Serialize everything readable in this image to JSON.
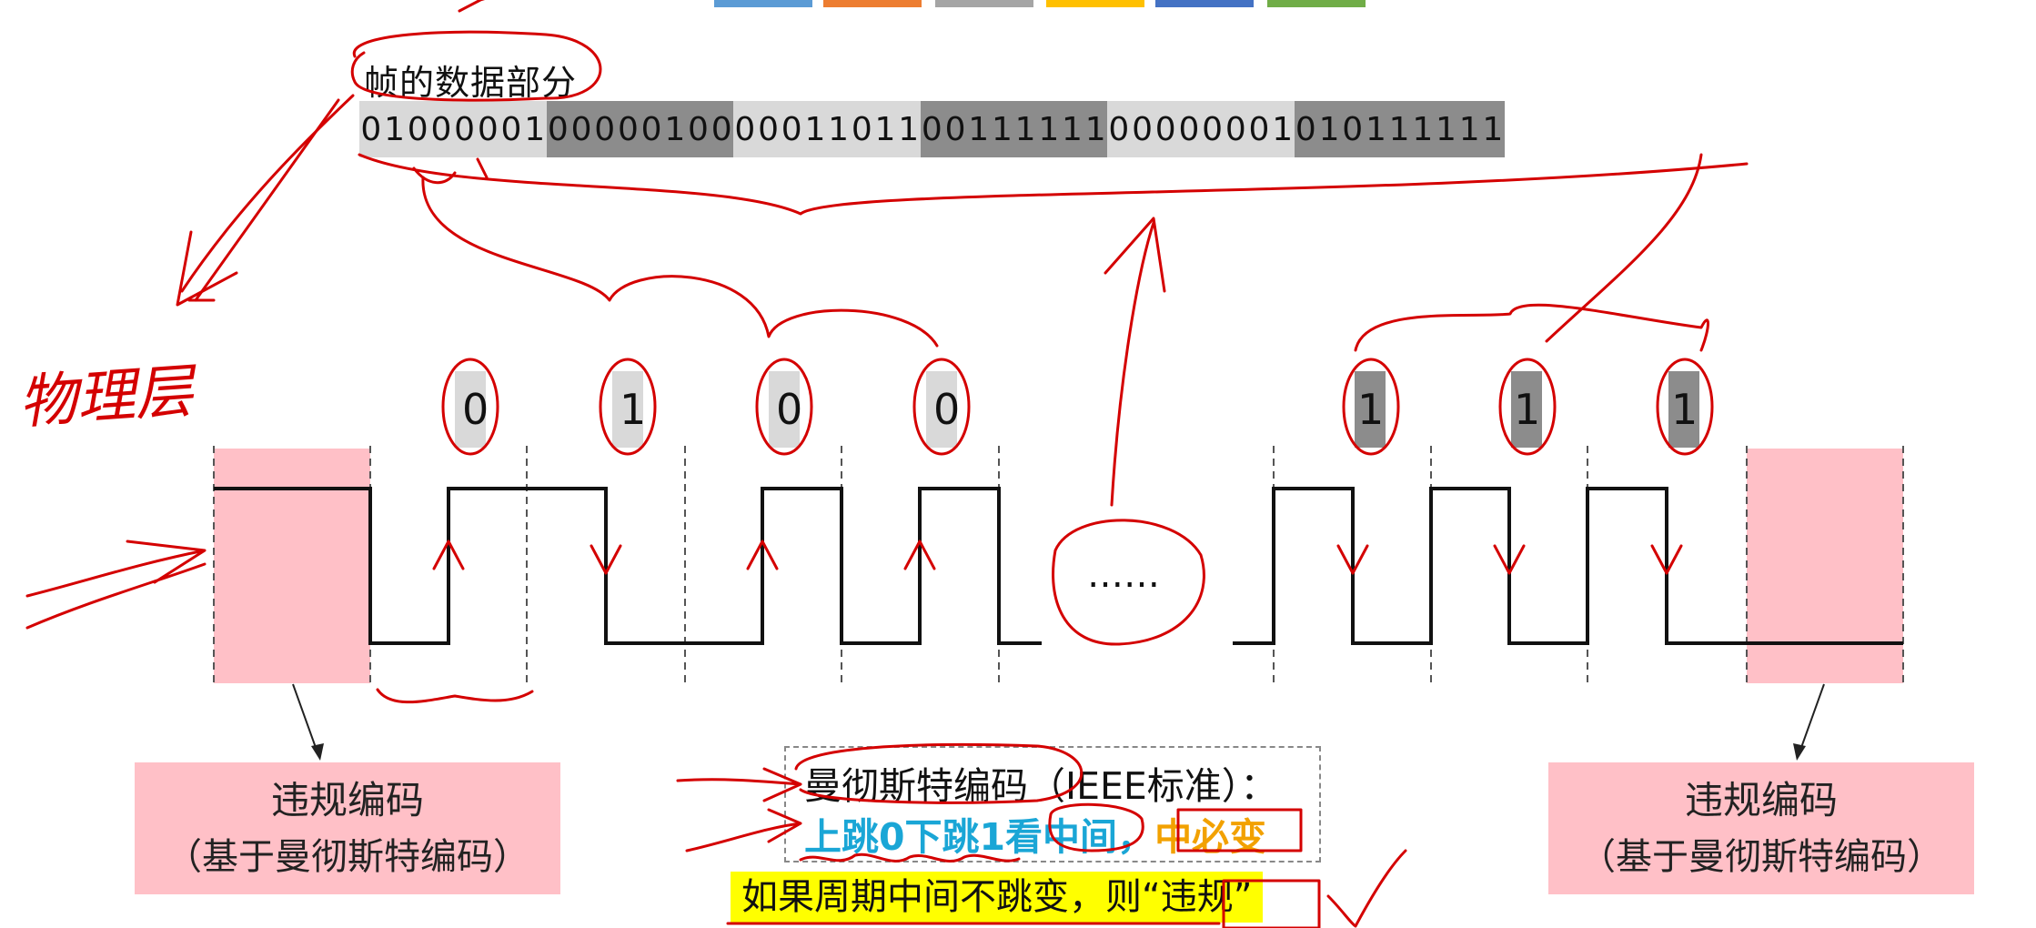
{
  "top_tab_colors": [
    "#5b9bd5",
    "#ed7d31",
    "#a5a5a5",
    "#ffc000",
    "#4472c4",
    "#70ad47"
  ],
  "frame_label": "帧的数据部分",
  "bit_string": "0100000100000100000110110011111100000001010111111",
  "bit_group_colors": [
    "#d9d9d9",
    "#8c8c8c",
    "#d9d9d9",
    "#8c8c8c",
    "#d9d9d9",
    "#8c8c8c"
  ],
  "signal_bits_left": [
    "0",
    "1",
    "0",
    "0"
  ],
  "signal_bits_right": [
    "1",
    "1",
    "1"
  ],
  "ellipsis": "……",
  "handwritten_layer": "物理层",
  "violation_left": {
    "line1": "违规编码",
    "line2": "（基于曼彻斯特编码）"
  },
  "violation_right": {
    "line1": "违规编码",
    "line2": "（基于曼彻斯特编码）"
  },
  "legend": {
    "line1": "曼彻斯特编码（IEEE标准）：",
    "line2_part1": "上跳0下跳1看中间，",
    "line2_part2": "中必变"
  },
  "warning": "如果周期中间不跳变，则“违规”",
  "colors": {
    "violation_fill": "#ffc0c7",
    "annotation_red": "#d40000",
    "highlight_yellow": "#ffff00"
  }
}
